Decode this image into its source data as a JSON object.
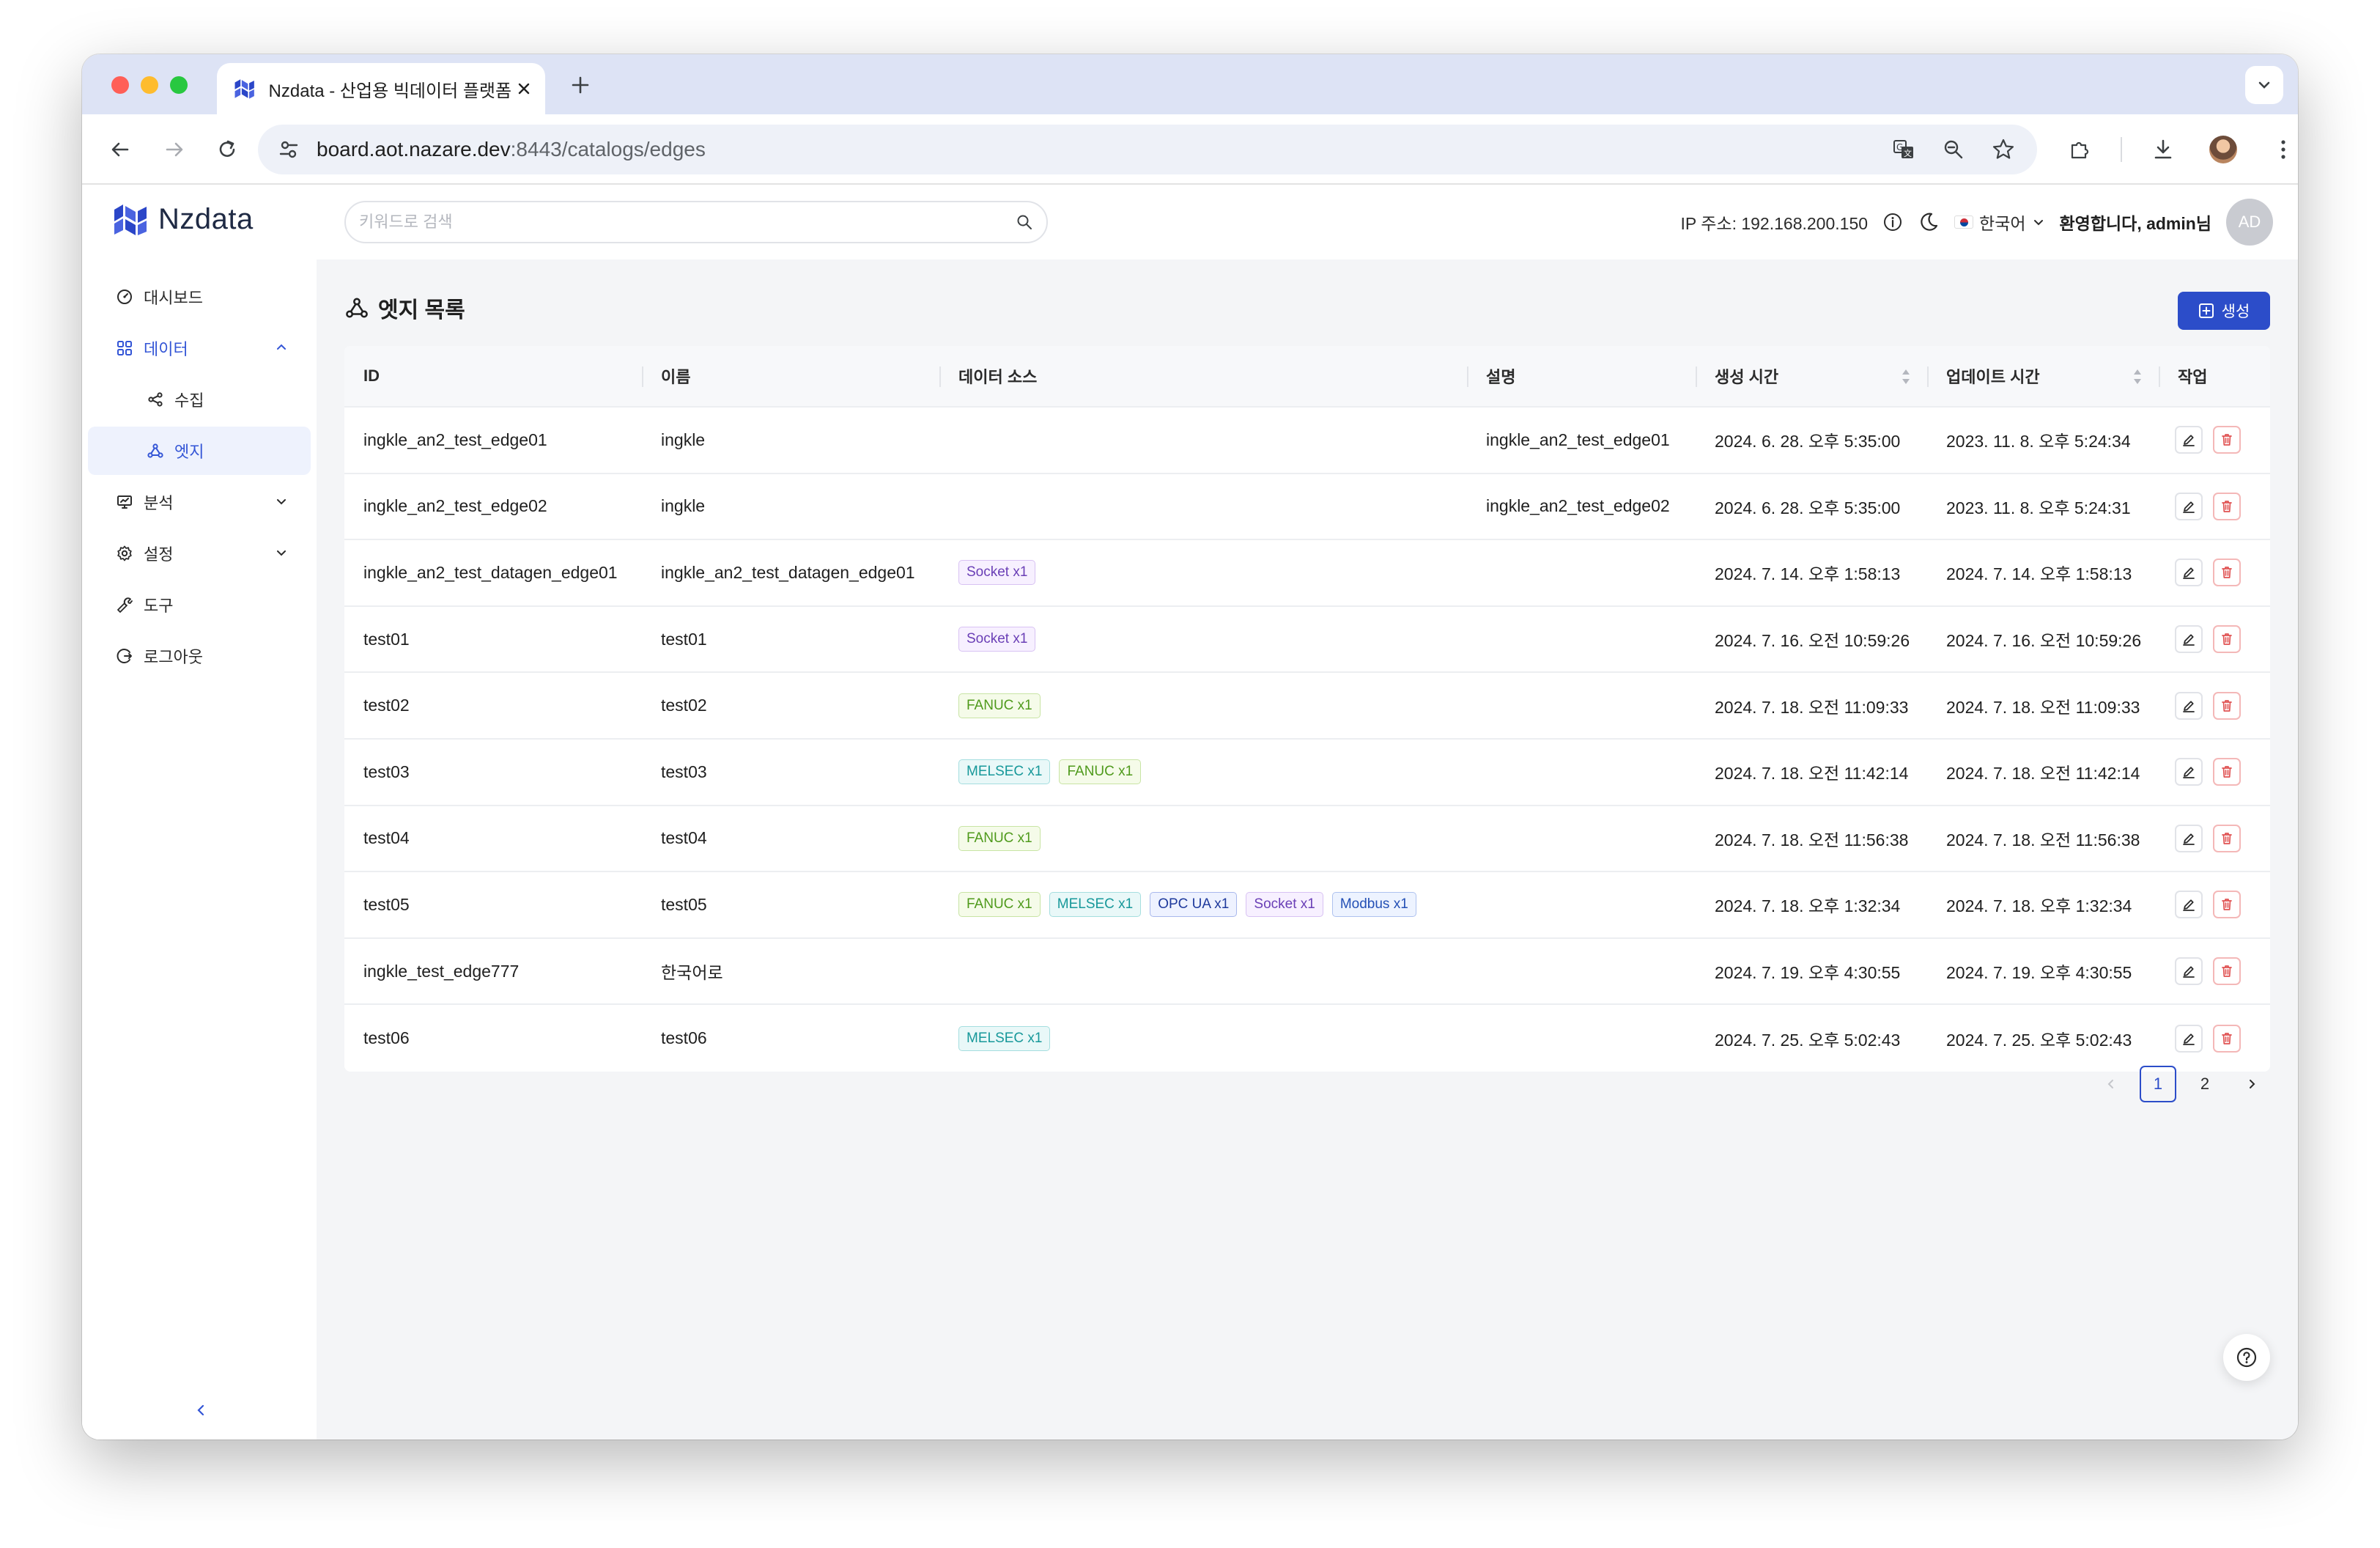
{
  "browser": {
    "tab_title": "Nzdata - 산업용 빅데이터 플랫폼",
    "url_host": "board.aot.nazare.dev",
    "url_path": ":8443/catalogs/edges"
  },
  "app": {
    "brand": "Nzdata",
    "search_placeholder": "키워드로 검색",
    "ip_label": "IP 주소: 192.168.200.150",
    "language": "한국어",
    "welcome": "환영합니다, admin님",
    "avatar_initials": "AD"
  },
  "sidebar": {
    "items": [
      {
        "label": "대시보드",
        "icon": "dashboard-icon"
      },
      {
        "label": "데이터",
        "icon": "data-grid-icon"
      },
      {
        "label": "수집",
        "icon": "share-icon"
      },
      {
        "label": "엣지",
        "icon": "edge-nodes-icon"
      },
      {
        "label": "분석",
        "icon": "monitor-icon"
      },
      {
        "label": "설정",
        "icon": "gear-icon"
      },
      {
        "label": "도구",
        "icon": "tool-icon"
      },
      {
        "label": "로그아웃",
        "icon": "logout-icon"
      }
    ]
  },
  "page": {
    "title": "엣지 목록",
    "create_label": "생성"
  },
  "table": {
    "columns": [
      "ID",
      "이름",
      "데이터 소스",
      "설명",
      "생성 시간",
      "업데이트 시간",
      "작업"
    ],
    "rows": [
      {
        "id": "ingkle_an2_test_edge01",
        "name": "ingkle",
        "sources": [],
        "desc": "ingkle_an2_test_edge01",
        "created": "2024. 6. 28. 오후 5:35:00",
        "updated": "2023. 11. 8. 오후 5:24:34"
      },
      {
        "id": "ingkle_an2_test_edge02",
        "name": "ingkle",
        "sources": [],
        "desc": "ingkle_an2_test_edge02",
        "created": "2024. 6. 28. 오후 5:35:00",
        "updated": "2023. 11. 8. 오후 5:24:31"
      },
      {
        "id": "ingkle_an2_test_datagen_edge01",
        "name": "ingkle_an2_test_datagen_edge01",
        "sources": [
          {
            "label": "Socket x1",
            "kind": "socket"
          }
        ],
        "desc": "",
        "created": "2024. 7. 14. 오후 1:58:13",
        "updated": "2024. 7. 14. 오후 1:58:13"
      },
      {
        "id": "test01",
        "name": "test01",
        "sources": [
          {
            "label": "Socket x1",
            "kind": "socket"
          }
        ],
        "desc": "",
        "created": "2024. 7. 16. 오전 10:59:26",
        "updated": "2024. 7. 16. 오전 10:59:26"
      },
      {
        "id": "test02",
        "name": "test02",
        "sources": [
          {
            "label": "FANUC x1",
            "kind": "fanuc"
          }
        ],
        "desc": "",
        "created": "2024. 7. 18. 오전 11:09:33",
        "updated": "2024. 7. 18. 오전 11:09:33"
      },
      {
        "id": "test03",
        "name": "test03",
        "sources": [
          {
            "label": "MELSEC x1",
            "kind": "melsec"
          },
          {
            "label": "FANUC x1",
            "kind": "fanuc"
          }
        ],
        "desc": "",
        "created": "2024. 7. 18. 오전 11:42:14",
        "updated": "2024. 7. 18. 오전 11:42:14"
      },
      {
        "id": "test04",
        "name": "test04",
        "sources": [
          {
            "label": "FANUC x1",
            "kind": "fanuc"
          }
        ],
        "desc": "",
        "created": "2024. 7. 18. 오전 11:56:38",
        "updated": "2024. 7. 18. 오전 11:56:38"
      },
      {
        "id": "test05",
        "name": "test05",
        "sources": [
          {
            "label": "FANUC x1",
            "kind": "fanuc"
          },
          {
            "label": "MELSEC x1",
            "kind": "melsec"
          },
          {
            "label": "OPC UA x1",
            "kind": "opcua"
          },
          {
            "label": "Socket x1",
            "kind": "socket"
          },
          {
            "label": "Modbus x1",
            "kind": "modbus"
          }
        ],
        "desc": "",
        "created": "2024. 7. 18. 오후 1:32:34",
        "updated": "2024. 7. 18. 오후 1:32:34"
      },
      {
        "id": "ingkle_test_edge777",
        "name": "한국어로",
        "sources": [],
        "desc": "",
        "created": "2024. 7. 19. 오후 4:30:55",
        "updated": "2024. 7. 19. 오후 4:30:55"
      },
      {
        "id": "test06",
        "name": "test06",
        "sources": [
          {
            "label": "MELSEC x1",
            "kind": "melsec"
          }
        ],
        "desc": "",
        "created": "2024. 7. 25. 오후 5:02:43",
        "updated": "2024. 7. 25. 오후 5:02:43"
      }
    ]
  },
  "pagination": {
    "pages": [
      "1",
      "2"
    ],
    "current": "1"
  },
  "colors": {
    "accent": "#2c4dc9",
    "brand": "#2b46c8"
  }
}
